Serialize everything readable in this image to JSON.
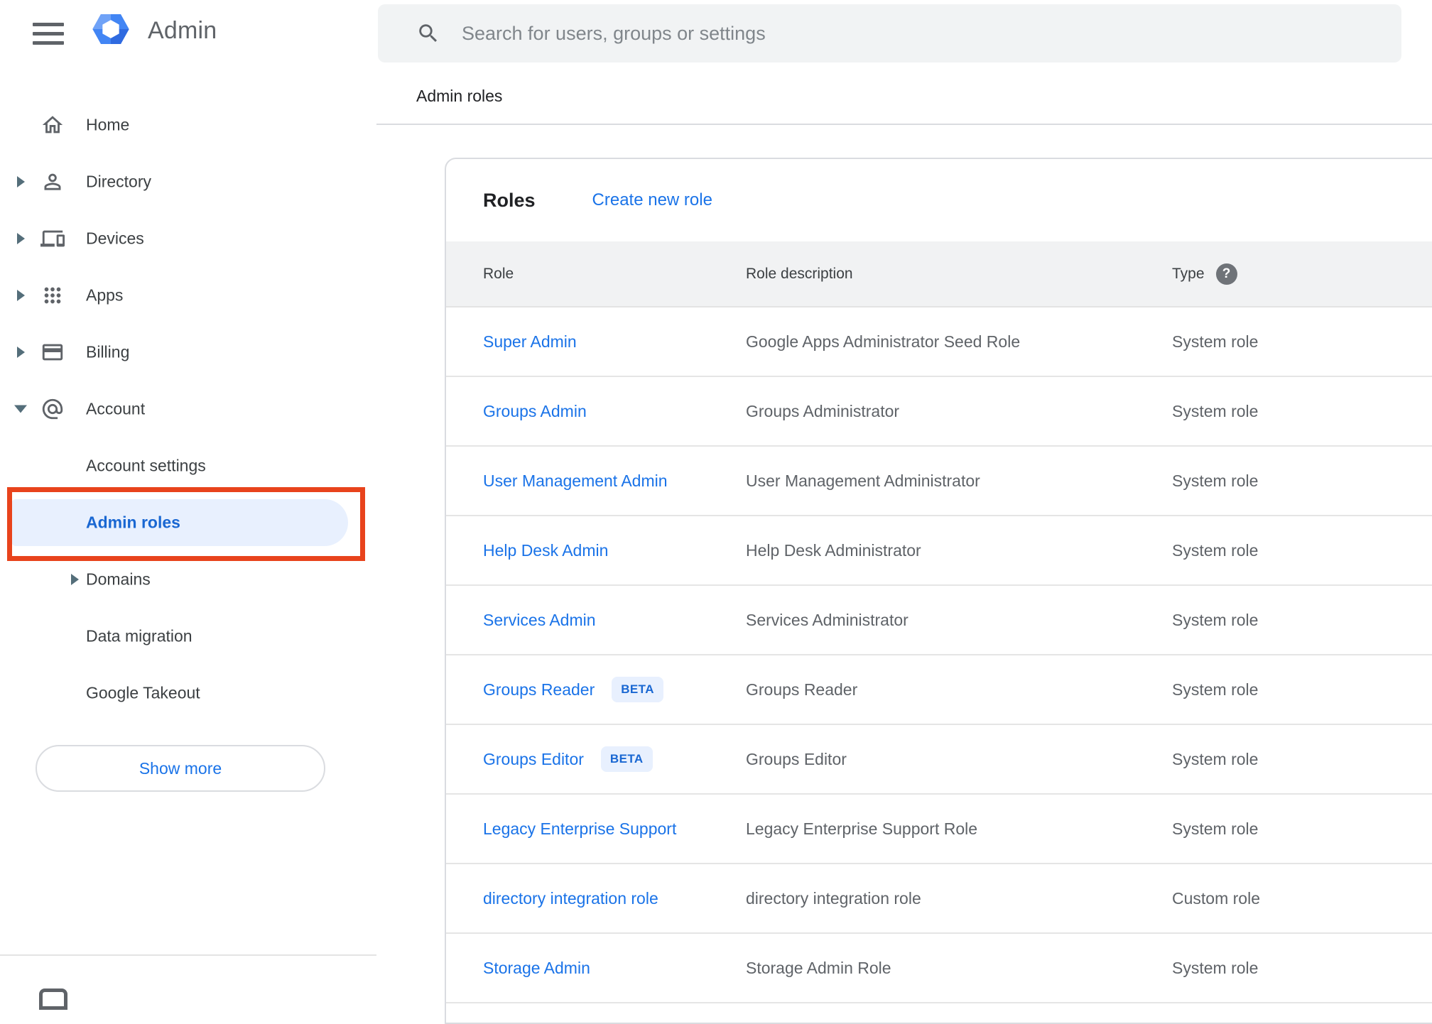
{
  "colors": {
    "accent": "#1a73e8",
    "selected_text": "#1967d2",
    "selected_bg": "#e8f0fe",
    "annotation_red": "#e8431c",
    "icon_gray": "#5f6368",
    "text_primary": "#202124",
    "text_secondary": "#5f6368",
    "surface_gray": "#f1f3f4"
  },
  "app": {
    "title": "Admin"
  },
  "search": {
    "placeholder": "Search for users, groups or settings"
  },
  "breadcrumb": {
    "label": "Admin roles"
  },
  "sidebar": {
    "items": [
      {
        "id": "home",
        "label": "Home",
        "icon": "home",
        "caret": "none",
        "level": 0,
        "selected": false
      },
      {
        "id": "directory",
        "label": "Directory",
        "icon": "person",
        "caret": "right",
        "level": 0,
        "selected": false
      },
      {
        "id": "devices",
        "label": "Devices",
        "icon": "devices",
        "caret": "right",
        "level": 0,
        "selected": false
      },
      {
        "id": "apps",
        "label": "Apps",
        "icon": "apps",
        "caret": "right",
        "level": 0,
        "selected": false
      },
      {
        "id": "billing",
        "label": "Billing",
        "icon": "card",
        "caret": "right",
        "level": 0,
        "selected": false
      },
      {
        "id": "account",
        "label": "Account",
        "icon": "at",
        "caret": "down",
        "level": 0,
        "selected": false
      },
      {
        "id": "account-settings",
        "label": "Account settings",
        "icon": "",
        "caret": "none",
        "level": 1,
        "selected": false
      },
      {
        "id": "admin-roles",
        "label": "Admin roles",
        "icon": "",
        "caret": "none",
        "level": 1,
        "selected": true
      },
      {
        "id": "domains",
        "label": "Domains",
        "icon": "",
        "caret": "right",
        "level": 1,
        "selected": false
      },
      {
        "id": "data-migration",
        "label": "Data migration",
        "icon": "",
        "caret": "none",
        "level": 1,
        "selected": false
      },
      {
        "id": "google-takeout",
        "label": "Google Takeout",
        "icon": "",
        "caret": "none",
        "level": 1,
        "selected": false
      }
    ],
    "show_more_label": "Show more"
  },
  "roles_panel": {
    "title": "Roles",
    "create_link_label": "Create new role",
    "columns": {
      "role": "Role",
      "description": "Role description",
      "type": "Type"
    },
    "help_icon_glyph": "?",
    "beta_label": "BETA",
    "rows": [
      {
        "role": "Super Admin",
        "beta": false,
        "description": "Google Apps Administrator Seed Role",
        "type": "System role"
      },
      {
        "role": "Groups Admin",
        "beta": false,
        "description": "Groups Administrator",
        "type": "System role"
      },
      {
        "role": "User Management Admin",
        "beta": false,
        "description": "User Management Administrator",
        "type": "System role"
      },
      {
        "role": "Help Desk Admin",
        "beta": false,
        "description": "Help Desk Administrator",
        "type": "System role"
      },
      {
        "role": "Services Admin",
        "beta": false,
        "description": "Services Administrator",
        "type": "System role"
      },
      {
        "role": "Groups Reader",
        "beta": true,
        "description": "Groups Reader",
        "type": "System role"
      },
      {
        "role": "Groups Editor",
        "beta": true,
        "description": "Groups Editor",
        "type": "System role"
      },
      {
        "role": "Legacy Enterprise Support",
        "beta": false,
        "description": "Legacy Enterprise Support Role",
        "type": "System role"
      },
      {
        "role": "directory integration role",
        "beta": false,
        "description": "directory integration role",
        "type": "Custom role"
      },
      {
        "role": "Storage Admin",
        "beta": false,
        "description": "Storage Admin Role",
        "type": "System role"
      }
    ]
  }
}
